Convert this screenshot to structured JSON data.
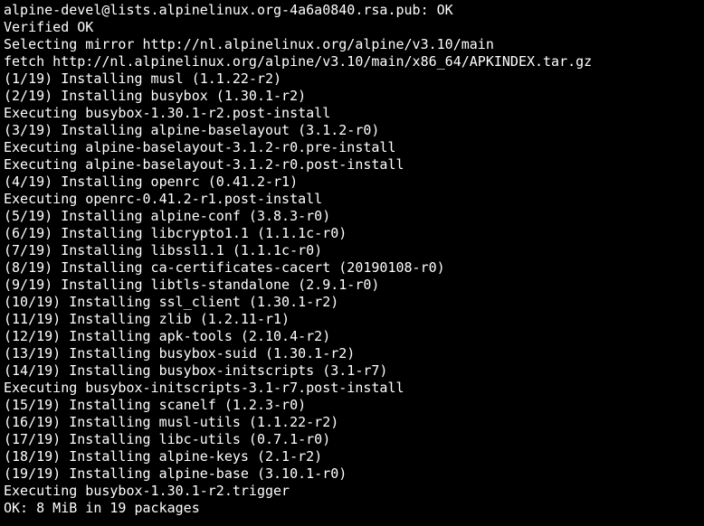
{
  "lines": [
    "alpine-devel@lists.alpinelinux.org-4a6a0840.rsa.pub: OK",
    "Verified OK",
    "Selecting mirror http://nl.alpinelinux.org/alpine/v3.10/main",
    "fetch http://nl.alpinelinux.org/alpine/v3.10/main/x86_64/APKINDEX.tar.gz",
    "(1/19) Installing musl (1.1.22-r2)",
    "(2/19) Installing busybox (1.30.1-r2)",
    "Executing busybox-1.30.1-r2.post-install",
    "(3/19) Installing alpine-baselayout (3.1.2-r0)",
    "Executing alpine-baselayout-3.1.2-r0.pre-install",
    "Executing alpine-baselayout-3.1.2-r0.post-install",
    "(4/19) Installing openrc (0.41.2-r1)",
    "Executing openrc-0.41.2-r1.post-install",
    "(5/19) Installing alpine-conf (3.8.3-r0)",
    "(6/19) Installing libcrypto1.1 (1.1.1c-r0)",
    "(7/19) Installing libssl1.1 (1.1.1c-r0)",
    "(8/19) Installing ca-certificates-cacert (20190108-r0)",
    "(9/19) Installing libtls-standalone (2.9.1-r0)",
    "(10/19) Installing ssl_client (1.30.1-r2)",
    "(11/19) Installing zlib (1.2.11-r1)",
    "(12/19) Installing apk-tools (2.10.4-r2)",
    "(13/19) Installing busybox-suid (1.30.1-r2)",
    "(14/19) Installing busybox-initscripts (3.1-r7)",
    "Executing busybox-initscripts-3.1-r7.post-install",
    "(15/19) Installing scanelf (1.2.3-r0)",
    "(16/19) Installing musl-utils (1.1.22-r2)",
    "(17/19) Installing libc-utils (0.7.1-r0)",
    "(18/19) Installing alpine-keys (2.1-r2)",
    "(19/19) Installing alpine-base (3.10.1-r0)",
    "Executing busybox-1.30.1-r2.trigger",
    "OK: 8 MiB in 19 packages"
  ]
}
